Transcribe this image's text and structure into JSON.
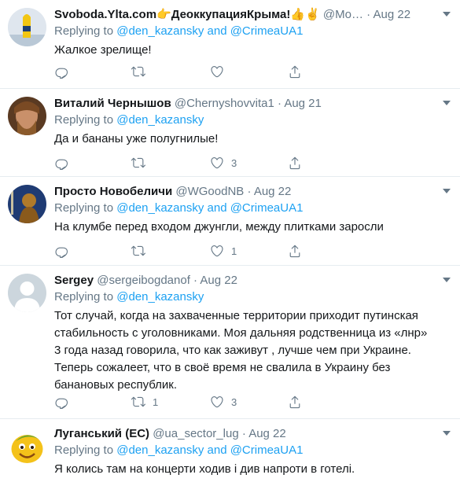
{
  "tweets": [
    {
      "name": "Svoboda.Ylta.com👉ДеоккупацияКрыма!👍✌️",
      "handle": "@Mo…",
      "dot": "·",
      "time": "Aug 22",
      "replying_prefix": "Replying to ",
      "replying_users": "@den_kazansky and @CrimeaUA1",
      "text": "Жалкое зрелище!",
      "retweets": "",
      "likes": ""
    },
    {
      "name": "Виталий Чернышов",
      "handle": "@Chernyshovvita1",
      "dot": "·",
      "time": "Aug 21",
      "replying_prefix": "Replying to ",
      "replying_users": "@den_kazansky",
      "text": "Да и бананы уже полугнилые!",
      "retweets": "",
      "likes": "3"
    },
    {
      "name": "Просто Новобеличи",
      "handle": "@WGoodNB",
      "dot": "·",
      "time": "Aug 22",
      "replying_prefix": "Replying to ",
      "replying_users": "@den_kazansky and @CrimeaUA1",
      "text": "На клумбе перед входом джунгли, между плитками заросли",
      "retweets": "",
      "likes": "1"
    },
    {
      "name": "Sergey",
      "handle": "@sergeibogdanof",
      "dot": "·",
      "time": "Aug 22",
      "replying_prefix": "Replying to ",
      "replying_users": "@den_kazansky",
      "text_lines": [
        "Тот случай, когда на захваченные территории приходит путинская",
        "стабильность с уголовниками. Моя дальняя родственница  из «лнр»",
        "3 года назад говорила, что как заживут , лучше чем при Украине.",
        "Теперь сожалеет, что в своё время не свалила в Украину без",
        "банановых республик."
      ],
      "retweets": "1",
      "likes": "3"
    },
    {
      "name": "Луганський (ЕС)",
      "handle": "@ua_sector_lug",
      "dot": "·",
      "time": "Aug 22",
      "replying_prefix": "Replying to ",
      "replying_users": "@den_kazansky and @CrimeaUA1",
      "text": "Я колись там на концерти ходив і див напроти в готелі."
    }
  ],
  "colors": {
    "link": "#1da1f2",
    "muted": "#657786",
    "text": "#14171a",
    "divider": "#e6ecf0"
  }
}
